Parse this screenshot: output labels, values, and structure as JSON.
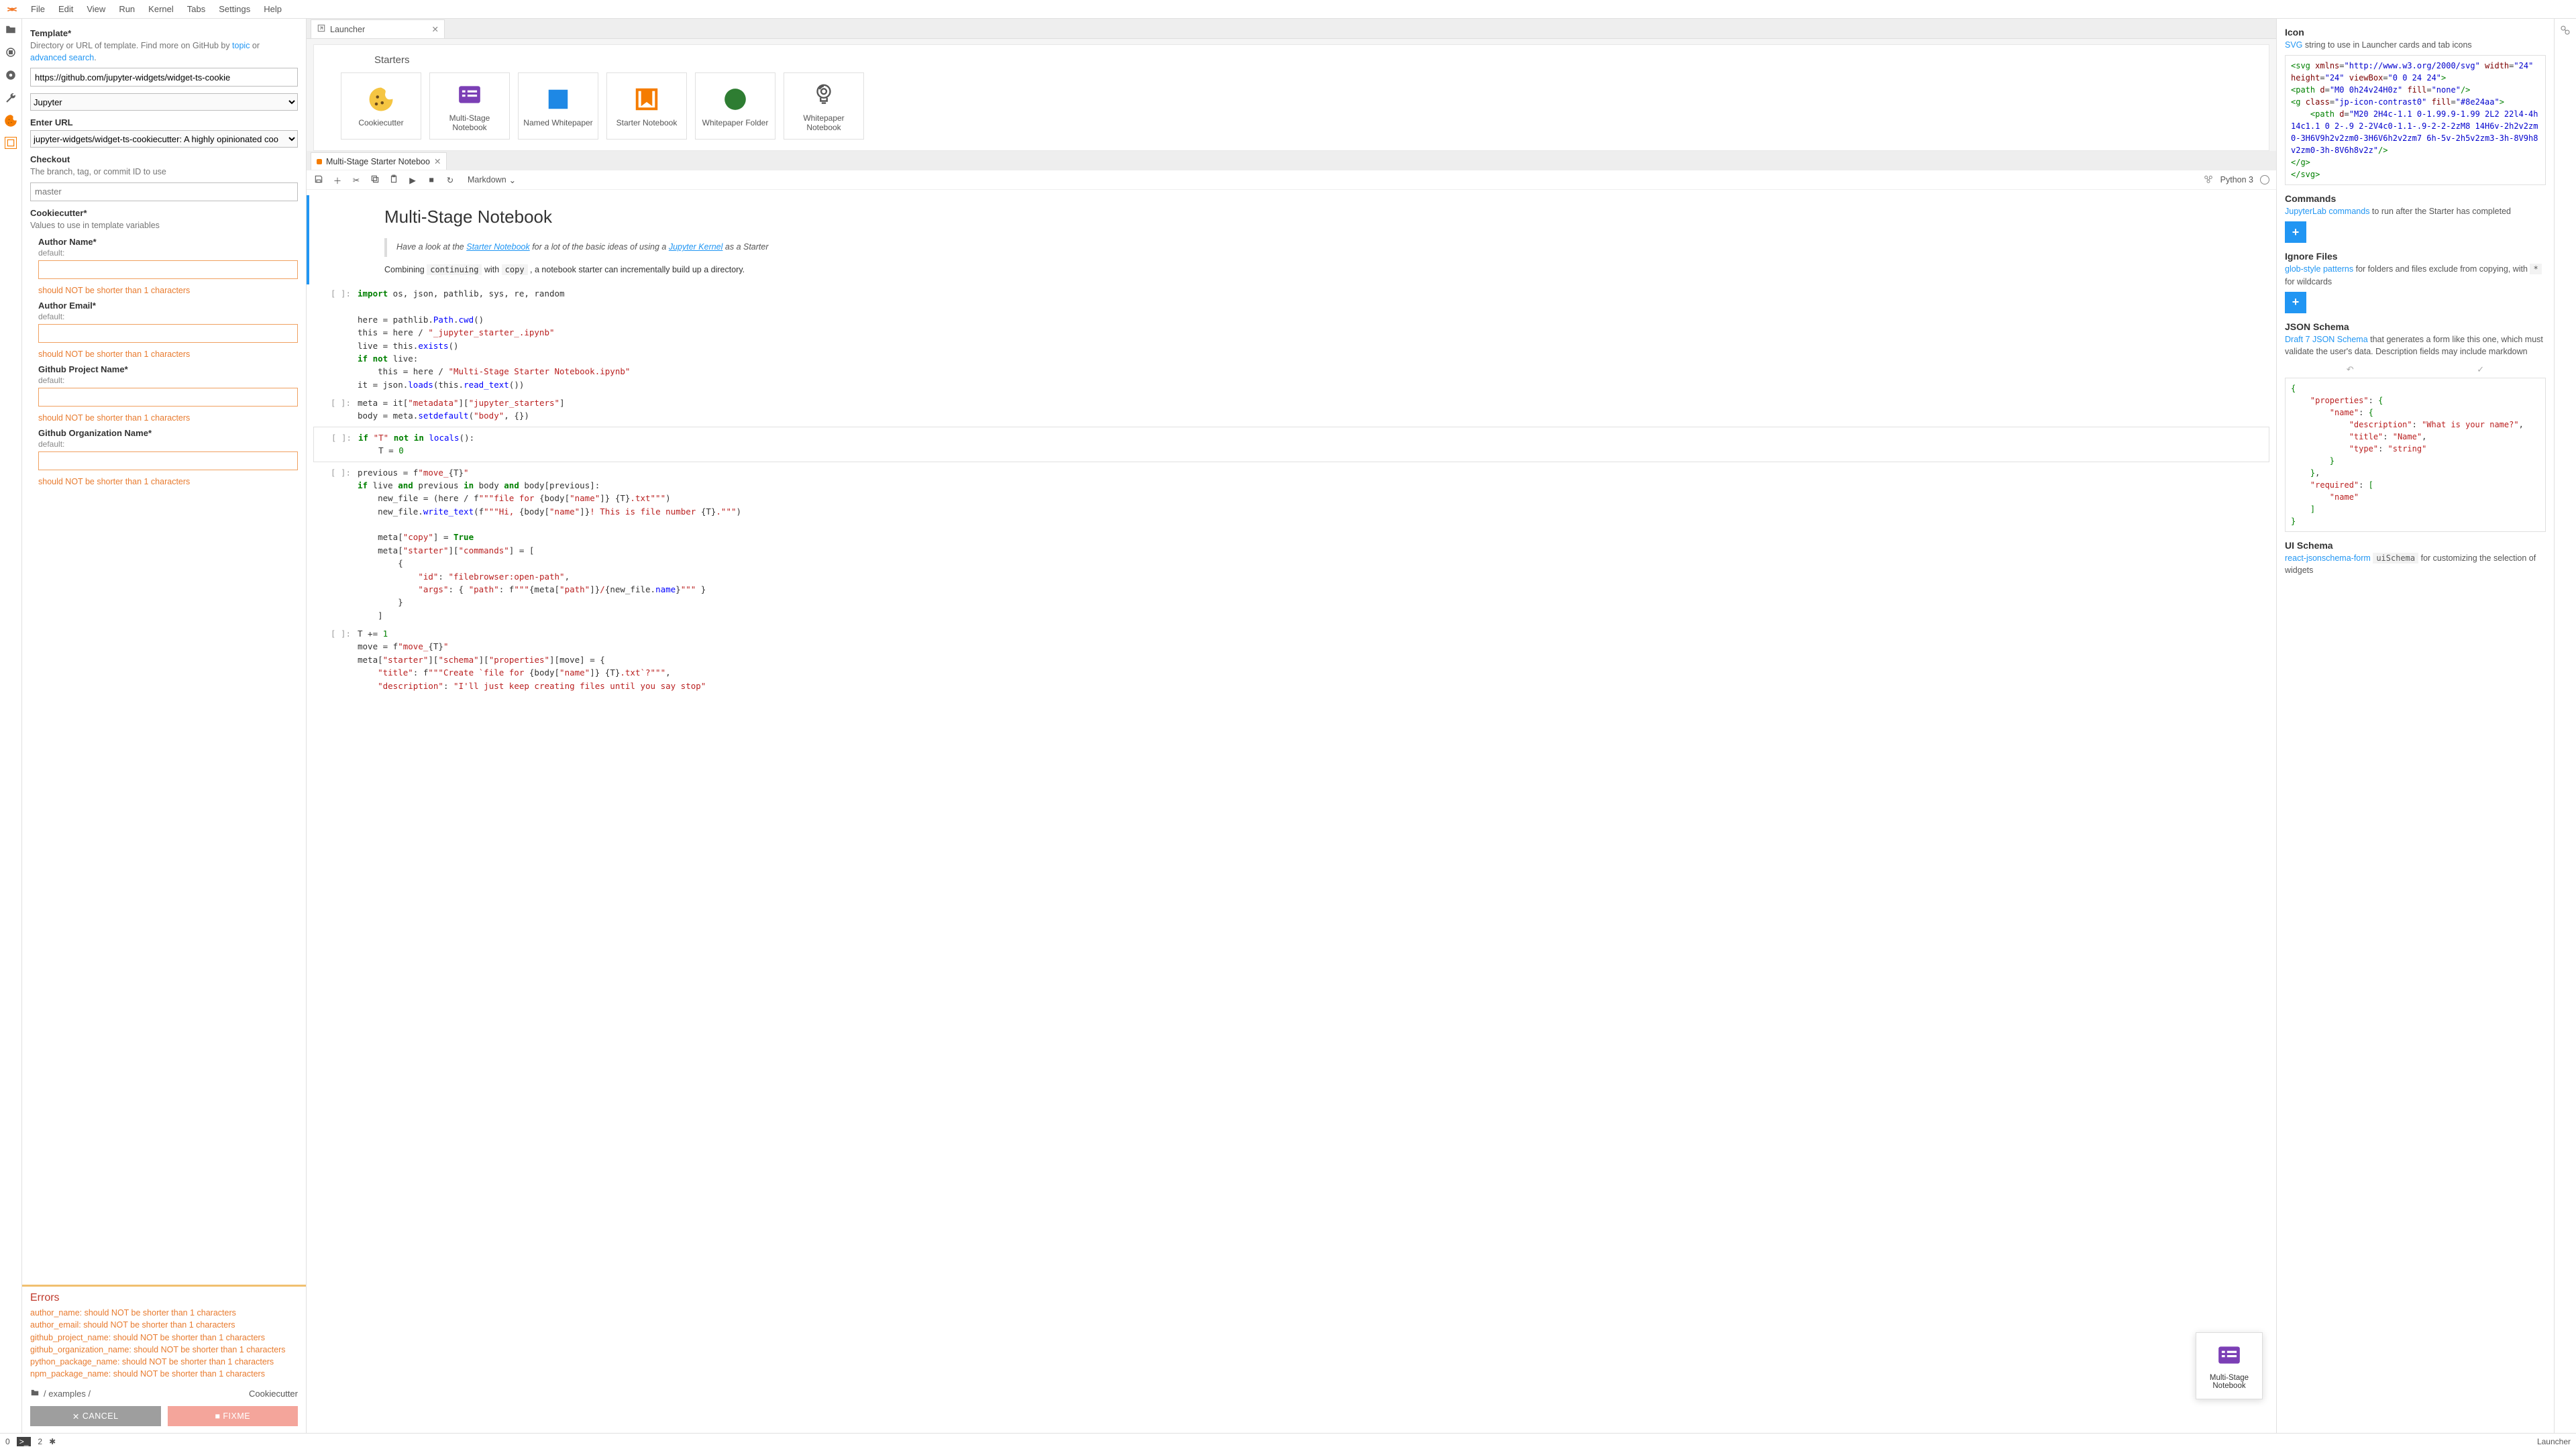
{
  "menu": {
    "items": [
      "File",
      "Edit",
      "View",
      "Run",
      "Kernel",
      "Tabs",
      "Settings",
      "Help"
    ]
  },
  "leftpanel": {
    "template": {
      "title": "Template*",
      "desc_prefix": "Directory or URL of template. Find more on GitHub by ",
      "link_topic": "topic",
      "desc_mid": " or ",
      "link_adv": "advanced search",
      "desc_suffix": ".",
      "value": "https://github.com/jupyter-widgets/widget-ts-cookie",
      "select": "Jupyter"
    },
    "enter_url": {
      "title": "Enter URL",
      "value": "jupyter-widgets/widget-ts-cookiecutter: A highly opinionated coo"
    },
    "checkout": {
      "title": "Checkout",
      "desc": "The branch, tag, or commit ID to use",
      "placeholder": "master"
    },
    "cookiecutter": {
      "title": "Cookiecutter*",
      "desc": "Values to use in template variables",
      "fields": [
        {
          "label": "Author Name*",
          "sub": "default:",
          "err": "should NOT be shorter than 1 characters"
        },
        {
          "label": "Author Email*",
          "sub": "default:",
          "err": "should NOT be shorter than 1 characters"
        },
        {
          "label": "Github Project Name*",
          "sub": "default:",
          "err": "should NOT be shorter than 1 characters"
        },
        {
          "label": "Github Organization Name*",
          "sub": "default:",
          "err": "should NOT be shorter than 1 characters"
        }
      ]
    },
    "errors": {
      "title": "Errors",
      "rows": [
        "author_name: should NOT be shorter than 1 characters",
        "author_email: should NOT be shorter than 1 characters",
        "github_project_name: should NOT be shorter than 1 characters",
        "github_organization_name: should NOT be shorter than 1 characters",
        "python_package_name: should NOT be shorter than 1 characters",
        "npm_package_name: should NOT be shorter than 1 characters"
      ]
    },
    "breadcrumb": {
      "path": "/ examples /",
      "right": "Cookiecutter"
    },
    "buttons": {
      "cancel": "CANCEL",
      "fixme": "FIXME"
    }
  },
  "launcher": {
    "tab": "Launcher",
    "section": "Starters",
    "cards": [
      {
        "label": "Cookiecutter",
        "icon": "cookie"
      },
      {
        "label": "Multi-Stage Notebook",
        "icon": "list"
      },
      {
        "label": "Named Whitepaper",
        "icon": "square"
      },
      {
        "label": "Starter Notebook",
        "icon": "bookmark"
      },
      {
        "label": "Whitepaper Folder",
        "icon": "circle"
      },
      {
        "label": "Whitepaper Notebook",
        "icon": "bulb"
      }
    ]
  },
  "notebook": {
    "tab": "Multi-Stage Starter Noteboo",
    "toolbar": {
      "celltype": "Markdown",
      "kernel": "Python 3"
    },
    "md": {
      "title": "Multi-Stage Notebook",
      "quote_pre": "Have a look at the ",
      "quote_l1": "Starter Notebook",
      "quote_mid": " for a lot of the basic ideas of using a ",
      "quote_l2": "Jupyter Kernel",
      "quote_post": " as a Starter",
      "line_pre": "Combining ",
      "code1": "continuing",
      "line_mid": " with ",
      "code2": "copy",
      "line_post": " , a notebook starter can incrementally build up a directory."
    }
  },
  "rightpanel": {
    "icon": {
      "title": "Icon",
      "link": "SVG",
      "desc": " string to use in Launcher cards and tab icons"
    },
    "commands": {
      "title": "Commands",
      "link": "JupyterLab commands",
      "desc": " to run after the Starter has completed"
    },
    "ignore": {
      "title": "Ignore Files",
      "link": "glob-style patterns",
      "desc1": " for folders and files exclude from copying, with ",
      "code": "*",
      "desc2": " for wildcards"
    },
    "jsonschema": {
      "title": "JSON Schema",
      "link": "Draft 7 JSON Schema",
      "desc": " that generates a form like this one, which must validate the user's data. Description fields may include markdown"
    },
    "uischema": {
      "title": "UI Schema",
      "link": "react-jsonschema-form",
      "code": "uiSchema",
      "desc": " for customizing the selection of widgets"
    }
  },
  "floatcard": {
    "label": "Multi-Stage Notebook"
  },
  "status": {
    "left_num": "0",
    "mid_num": "2",
    "right": "Launcher"
  }
}
